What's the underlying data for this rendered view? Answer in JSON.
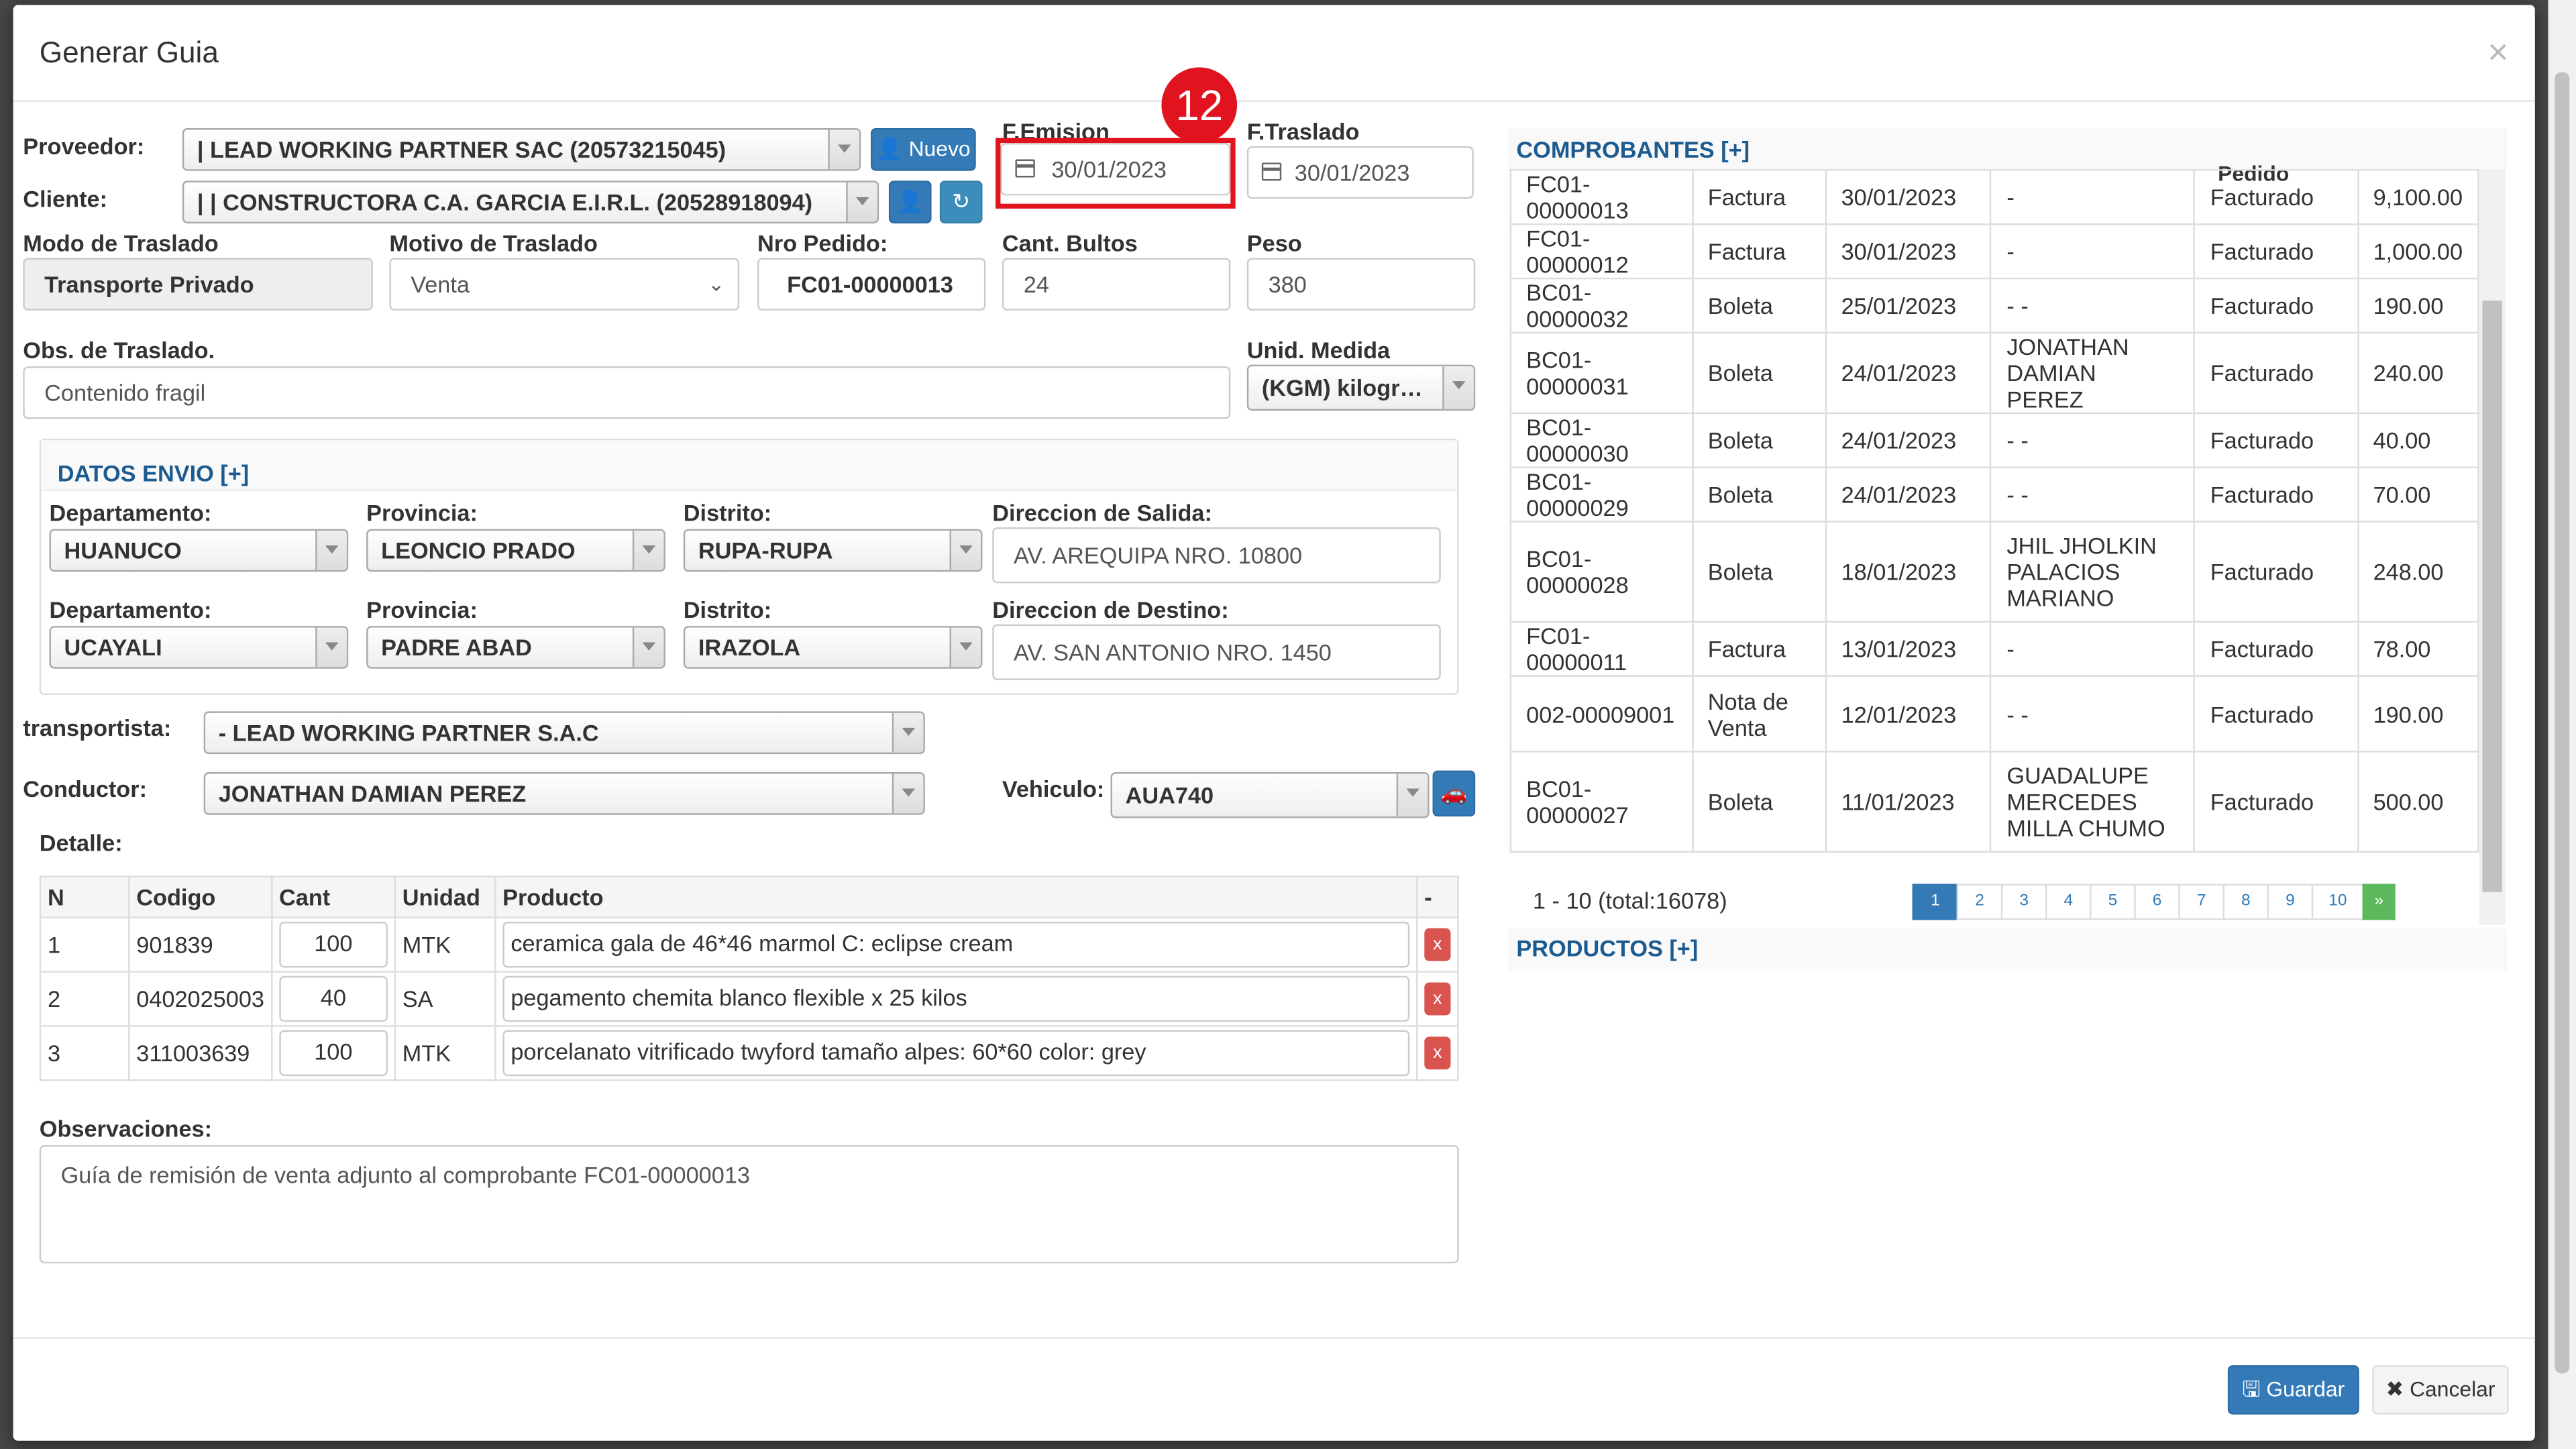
{
  "modal": {
    "title": "Generar Guia"
  },
  "form": {
    "proveedor_label": "Proveedor:",
    "proveedor_value": "| LEAD WORKING PARTNER SAC (20573215045)",
    "nuevo_label": "Nuevo",
    "cliente_label": "Cliente:",
    "cliente_value": "| | CONSTRUCTORA C.A. GARCIA E.I.R.L. (20528918094)",
    "femision_label": "F.Emision",
    "femision_value": "30/01/2023",
    "ftraslado_label": "F.Traslado",
    "ftraslado_value": "30/01/2023",
    "step_badge": "12",
    "modo_label": "Modo de Traslado",
    "modo_value": "Transporte Privado",
    "motivo_label": "Motivo de Traslado",
    "motivo_value": "Venta",
    "nro_pedido_label": "Nro Pedido:",
    "nro_pedido_value": "FC01-00000013",
    "cant_bultos_label": "Cant. Bultos",
    "cant_bultos_value": "24",
    "peso_label": "Peso",
    "peso_value": "380",
    "obs_traslado_label": "Obs. de Traslado.",
    "obs_traslado_value": "Contenido fragil",
    "unid_medida_label": "Unid. Medida",
    "unid_medida_value": "(KGM) kilogr…"
  },
  "envio": {
    "title": "DATOS ENVIO [+]",
    "departamento_label": "Departamento:",
    "provincia_label": "Provincia:",
    "distrito_label": "Distrito:",
    "salida_label": "Direccion de Salida:",
    "destino_label": "Direccion de Destino:",
    "origen_departamento": "HUANUCO",
    "origen_provincia": "LEONCIO PRADO",
    "origen_distrito": "RUPA-RUPA",
    "origen_direccion": "AV. AREQUIPA NRO. 10800",
    "destino_departamento": "UCAYALI",
    "destino_provincia": "PADRE ABAD",
    "destino_distrito": "IRAZOLA",
    "destino_direccion": "AV. SAN ANTONIO NRO. 1450"
  },
  "transporte": {
    "transportista_label": "transportista:",
    "transportista_value": "- LEAD WORKING PARTNER S.A.C",
    "conductor_label": "Conductor:",
    "conductor_value": "JONATHAN DAMIAN PEREZ",
    "vehiculo_label": "Vehiculo:",
    "vehiculo_value": "AUA740"
  },
  "detalle": {
    "title": "Detalle:",
    "headers": [
      "N",
      "Codigo",
      "Cant",
      "Unidad",
      "Producto",
      "-"
    ],
    "remove_label": "x",
    "rows": [
      {
        "n": "1",
        "codigo": "901839",
        "cant": "100",
        "unidad": "MTK",
        "producto": "ceramica gala de 46*46 marmol C: eclipse cream"
      },
      {
        "n": "2",
        "codigo": "0402025003",
        "cant": "40",
        "unidad": "SA",
        "producto": "pegamento chemita blanco flexible x 25 kilos"
      },
      {
        "n": "3",
        "codigo": "311003639",
        "cant": "100",
        "unidad": "MTK",
        "producto": "porcelanato vitrificado twyford tamaño alpes: 60*60 color: grey"
      }
    ]
  },
  "observaciones": {
    "label": "Observaciones:",
    "value": "Guía de remisión de venta adjunto al comprobante FC01-00000013"
  },
  "comprobantes": {
    "title": "COMPROBANTES [+]",
    "partial_header": "Pedido",
    "rows": [
      {
        "numero": "FC01-00000013",
        "tipo": "Factura",
        "fecha": "30/01/2023",
        "cliente": "-",
        "estado": "Facturado",
        "total": "9,100.00"
      },
      {
        "numero": "FC01-00000012",
        "tipo": "Factura",
        "fecha": "30/01/2023",
        "cliente": "-",
        "estado": "Facturado",
        "total": "1,000.00"
      },
      {
        "numero": "BC01-00000032",
        "tipo": "Boleta",
        "fecha": "25/01/2023",
        "cliente": "- -",
        "estado": "Facturado",
        "total": "190.00"
      },
      {
        "numero": "BC01-00000031",
        "tipo": "Boleta",
        "fecha": "24/01/2023",
        "cliente": "JONATHAN DAMIAN PEREZ",
        "estado": "Facturado",
        "total": "240.00"
      },
      {
        "numero": "BC01-00000030",
        "tipo": "Boleta",
        "fecha": "24/01/2023",
        "cliente": "- -",
        "estado": "Facturado",
        "total": "40.00"
      },
      {
        "numero": "BC01-00000029",
        "tipo": "Boleta",
        "fecha": "24/01/2023",
        "cliente": "- -",
        "estado": "Facturado",
        "total": "70.00"
      },
      {
        "numero": "BC01-00000028",
        "tipo": "Boleta",
        "fecha": "18/01/2023",
        "cliente": "JHIL JHOLKIN PALACIOS MARIANO",
        "estado": "Facturado",
        "total": "248.00"
      },
      {
        "numero": "FC01-00000011",
        "tipo": "Factura",
        "fecha": "13/01/2023",
        "cliente": "-",
        "estado": "Facturado",
        "total": "78.00"
      },
      {
        "numero": "002-00009001",
        "tipo": "Nota de Venta",
        "fecha": "12/01/2023",
        "cliente": "- -",
        "estado": "Facturado",
        "total": "190.00"
      },
      {
        "numero": "BC01-00000027",
        "tipo": "Boleta",
        "fecha": "11/01/2023",
        "cliente": "GUADALUPE MERCEDES MILLA CHUMO",
        "estado": "Facturado",
        "total": "500.00"
      }
    ],
    "summary": "1 - 10 (total:16078)",
    "pages": [
      "1",
      "2",
      "3",
      "4",
      "5",
      "6",
      "7",
      "8",
      "9",
      "10"
    ],
    "next_label": "»"
  },
  "productos": {
    "title": "PRODUCTOS [+]"
  },
  "footer": {
    "guardar_label": "Guardar",
    "cancelar_label": "Cancelar"
  },
  "colors": {
    "primary": "#337ab7",
    "danger": "#d9534f",
    "success": "#5cb85c",
    "highlight": "#e0131f"
  }
}
